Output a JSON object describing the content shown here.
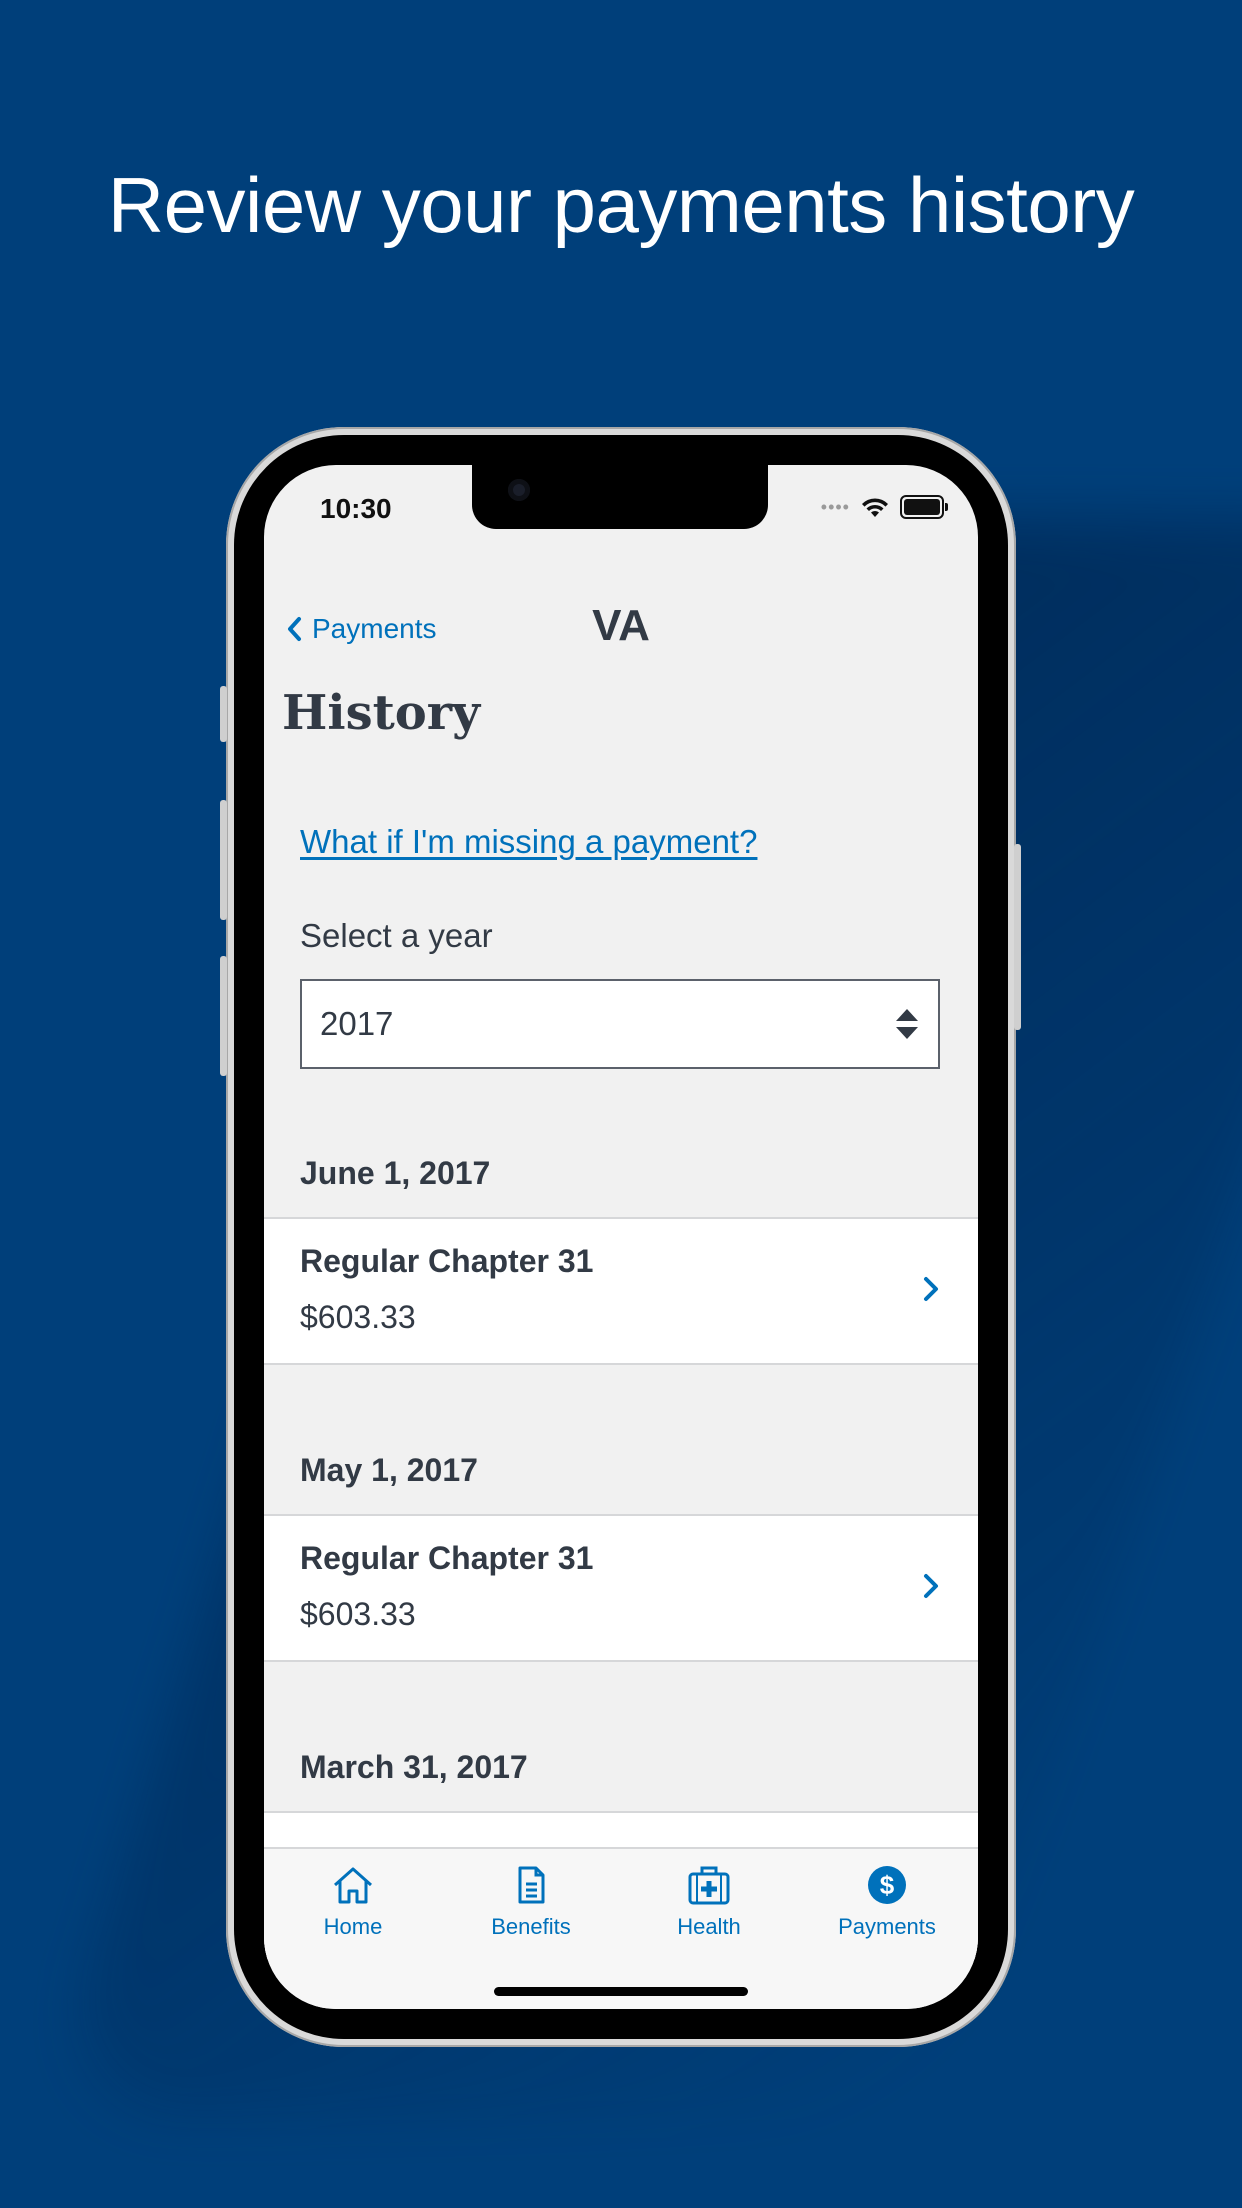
{
  "headline": "Review your payments history",
  "status_bar": {
    "time": "10:30",
    "signal_text": "••••"
  },
  "nav": {
    "back_label": "Payments",
    "title": "VA"
  },
  "page": {
    "title": "History",
    "help_link": "What if I'm missing a payment?",
    "select_label": "Select a year",
    "selected_year": "2017"
  },
  "payment_groups": [
    {
      "date": "June 1, 2017",
      "items": [
        {
          "title": "Regular Chapter 31",
          "amount": "$603.33"
        }
      ]
    },
    {
      "date": "May 1, 2017",
      "items": [
        {
          "title": "Regular Chapter 31",
          "amount": "$603.33"
        }
      ]
    },
    {
      "date": "March 31, 2017",
      "items": []
    }
  ],
  "tabs": [
    {
      "label": "Home",
      "icon": "home-icon",
      "active": false
    },
    {
      "label": "Benefits",
      "icon": "document-icon",
      "active": false
    },
    {
      "label": "Health",
      "icon": "medical-kit-icon",
      "active": false
    },
    {
      "label": "Payments",
      "icon": "dollar-icon",
      "active": true
    }
  ],
  "colors": {
    "background": "#003f7a",
    "link": "#0071bb",
    "text": "#323a45",
    "screen_bg": "#f1f1f1"
  }
}
